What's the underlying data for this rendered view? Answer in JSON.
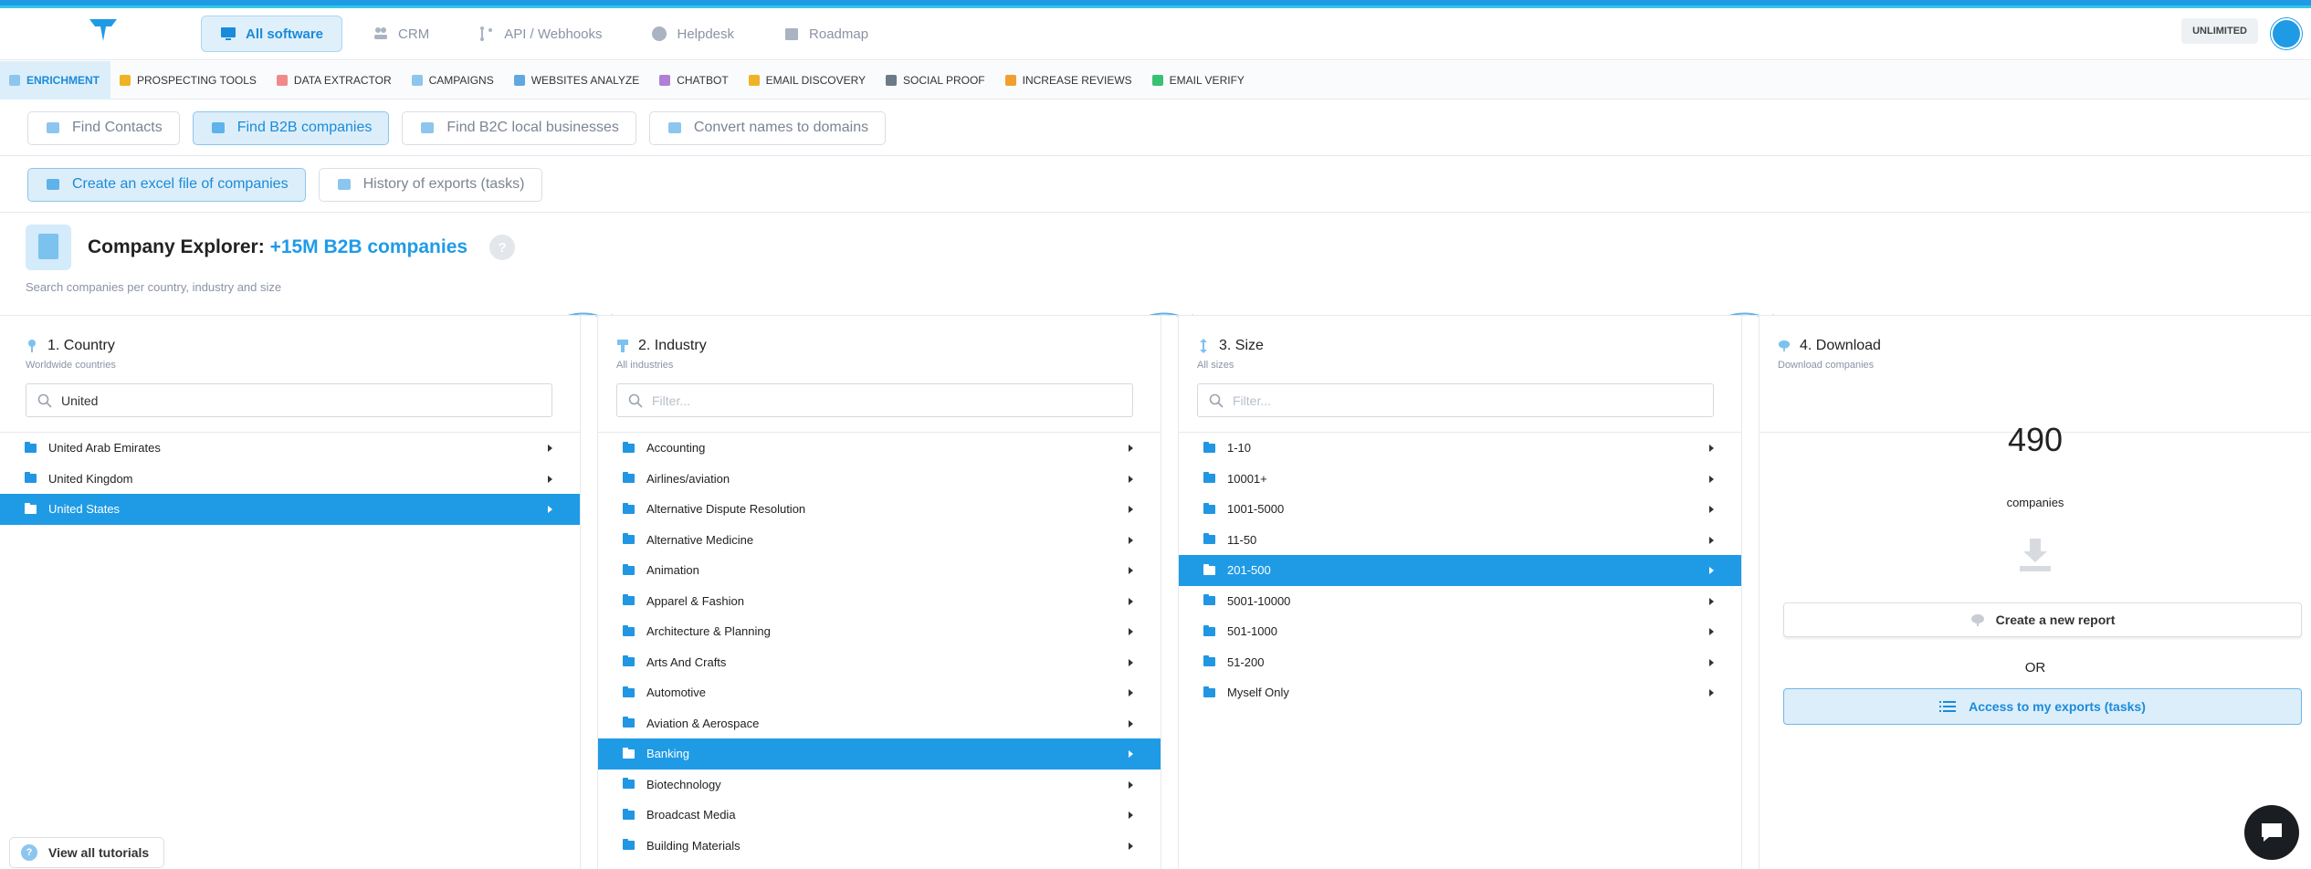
{
  "topnav": {
    "tabs": [
      {
        "label": "All software",
        "icon": "monitor-icon",
        "active": true
      },
      {
        "label": "CRM",
        "icon": "people-icon"
      },
      {
        "label": "API / Webhooks",
        "icon": "branch-icon"
      },
      {
        "label": "Helpdesk",
        "icon": "question-icon"
      },
      {
        "label": "Roadmap",
        "icon": "calendar-icon"
      }
    ],
    "plan_badge": "UNLIMITED"
  },
  "toolbar": {
    "items": [
      {
        "label": "ENRICHMENT",
        "color": "#8cc6ee",
        "active": true
      },
      {
        "label": "PROSPECTING TOOLS",
        "color": "#f0b323"
      },
      {
        "label": "DATA EXTRACTOR",
        "color": "#f08a8a"
      },
      {
        "label": "CAMPAIGNS",
        "color": "#8cc6ee"
      },
      {
        "label": "WEBSITES ANALYZE",
        "color": "#5fa8e0"
      },
      {
        "label": "CHATBOT",
        "color": "#b07fd6"
      },
      {
        "label": "EMAIL DISCOVERY",
        "color": "#f0b323"
      },
      {
        "label": "SOCIAL PROOF",
        "color": "#6c7a89"
      },
      {
        "label": "INCREASE REVIEWS",
        "color": "#f0a030"
      },
      {
        "label": "EMAIL VERIFY",
        "color": "#38c172"
      }
    ]
  },
  "subtabs": [
    {
      "label": "Find Contacts",
      "active": false
    },
    {
      "label": "Find B2B companies",
      "active": true
    },
    {
      "label": "Find B2C local businesses",
      "active": false
    },
    {
      "label": "Convert names to domains",
      "active": false
    }
  ],
  "actions": [
    {
      "label": "Create an excel file of companies",
      "active": true
    },
    {
      "label": "History of exports (tasks)",
      "active": false
    }
  ],
  "explorer": {
    "title": "Company Explorer:",
    "title_accent": "+15M B2B companies",
    "help": "?",
    "subtitle": "Search companies per country, industry and size"
  },
  "country": {
    "title": "1. Country",
    "subtitle": "Worldwide countries",
    "search_value": "United",
    "items": [
      "United Arab Emirates",
      "United Kingdom",
      "United States"
    ],
    "selected": "United States"
  },
  "industry": {
    "title": "2. Industry",
    "subtitle": "All industries",
    "search_placeholder": "Filter...",
    "items": [
      "Accounting",
      "Airlines/aviation",
      "Alternative Dispute Resolution",
      "Alternative Medicine",
      "Animation",
      "Apparel & Fashion",
      "Architecture & Planning",
      "Arts And Crafts",
      "Automotive",
      "Aviation & Aerospace",
      "Banking",
      "Biotechnology",
      "Broadcast Media",
      "Building Materials"
    ],
    "selected": "Banking"
  },
  "size": {
    "title": "3. Size",
    "subtitle": "All sizes",
    "search_placeholder": "Filter...",
    "items": [
      "1-10",
      "10001+",
      "1001-5000",
      "11-50",
      "201-500",
      "5001-10000",
      "501-1000",
      "51-200",
      "Myself Only"
    ],
    "selected": "201-500"
  },
  "download": {
    "title": "4. Download",
    "subtitle": "Download companies",
    "count": "490",
    "count_label": "companies",
    "report_button": "Create a new report",
    "or": "OR",
    "access_button": "Access to my exports (tasks)"
  },
  "footer": {
    "tutorials": "View all tutorials"
  },
  "colors": {
    "primary": "#1f9be6",
    "selected_row": "#1f9be6",
    "active_tab_bg": "#dceefa"
  }
}
